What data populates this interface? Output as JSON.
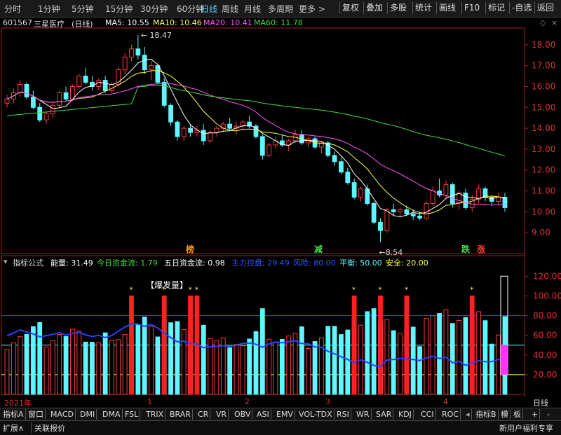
{
  "toolbar": {
    "tabs": [
      "分时",
      "1分钟",
      "5分钟",
      "15分钟",
      "30分钟",
      "60分钟",
      "日线",
      "周线",
      "月线",
      "多周期",
      "更多 >"
    ],
    "active_tab": "日线",
    "right_buttons": [
      "复权",
      "叠加",
      "多股",
      "统计",
      "画线",
      "F10",
      "标记",
      "-自选",
      "返回"
    ]
  },
  "stock": {
    "code": "601567",
    "name": "三星医疗",
    "period": "(日线)",
    "ma5": "MA5: 10.55",
    "ma10": "MA10: 10.46",
    "ma20": "MA20: 10.41",
    "ma60": "MA60: 11.78",
    "high_label": "18.47",
    "low_label": "8.54"
  },
  "price_axis": [
    18.0,
    17.0,
    16.0,
    15.0,
    14.0,
    13.0,
    12.0,
    11.0,
    10.0,
    9.0
  ],
  "markers": [
    "榜",
    "减",
    "跌",
    "涨"
  ],
  "indicator": {
    "name": "指标公式",
    "energy": "能量: 31.49",
    "today_flow": "今日资金流: 1.79",
    "five_day_flow": "五日资金流: 0.98",
    "main_control": "主力控盘: 29.49",
    "risk": "风险: 80.00",
    "balance": "平衡: 50.00",
    "safe": "安全: 20.00",
    "annotation": "【爆发量】",
    "axis": [
      120.0,
      100.0,
      80.0,
      60.0,
      40.0,
      20.0
    ]
  },
  "dates": [
    "2021年",
    "1",
    "2",
    "3",
    "4"
  ],
  "indicator_tabs": [
    "指标A",
    "窗口",
    "MACD",
    "DMI",
    "DMA",
    "FSL",
    "TRIX",
    "BRAR",
    "CR",
    "VR",
    "OBV",
    "ASI",
    "EMV",
    "VOL-TDX",
    "RSI",
    "WR",
    "SAR",
    "KDJ",
    "CCI",
    "ROC",
    "指标B",
    "模",
    "板",
    "+",
    "-"
  ],
  "period_label": "日线",
  "bottom": {
    "left1": "扩展∧",
    "left2": "关联报价",
    "right": "新用户福利专享"
  },
  "colors": {
    "up": "#ff3b3b",
    "down": "#5ef6ff",
    "ma5": "#ffffff",
    "ma10": "#ffff55",
    "ma20": "#ff55ff",
    "ma60": "#44dd44",
    "accent": "#5bc8ff"
  },
  "chart_data": [
    {
      "type": "candlestick",
      "title": "601567 三星医疗 (日线)",
      "ylim": [
        8.0,
        18.8
      ],
      "y_ticks": [
        18,
        17,
        16,
        15,
        14,
        13,
        12,
        11,
        10,
        9
      ],
      "x_labels": [
        "2021年",
        "1",
        "2",
        "3",
        "4"
      ],
      "ohlc": [
        [
          15.2,
          15.6,
          15.0,
          15.4
        ],
        [
          15.4,
          15.9,
          15.2,
          15.7
        ],
        [
          15.7,
          16.3,
          15.5,
          16.1
        ],
        [
          16.1,
          16.2,
          15.4,
          15.5
        ],
        [
          15.5,
          15.8,
          14.9,
          15.0
        ],
        [
          15.0,
          15.2,
          14.3,
          14.4
        ],
        [
          14.4,
          14.8,
          14.2,
          14.7
        ],
        [
          14.7,
          15.2,
          14.5,
          15.1
        ],
        [
          15.1,
          15.8,
          15.0,
          15.7
        ],
        [
          15.7,
          16.0,
          15.3,
          15.4
        ],
        [
          15.4,
          16.1,
          15.3,
          16.0
        ],
        [
          16.0,
          16.6,
          15.9,
          16.5
        ],
        [
          16.5,
          16.9,
          16.1,
          16.2
        ],
        [
          16.2,
          16.5,
          15.8,
          16.0
        ],
        [
          16.0,
          16.4,
          15.8,
          16.3
        ],
        [
          16.3,
          16.5,
          15.7,
          15.8
        ],
        [
          15.8,
          16.2,
          15.7,
          16.1
        ],
        [
          16.1,
          16.9,
          16.0,
          16.8
        ],
        [
          16.8,
          17.6,
          16.6,
          17.4
        ],
        [
          17.4,
          18.0,
          17.2,
          17.8
        ],
        [
          17.8,
          18.47,
          17.3,
          17.5
        ],
        [
          17.5,
          17.9,
          16.6,
          16.8
        ],
        [
          16.8,
          17.2,
          16.3,
          17.0
        ],
        [
          17.0,
          17.1,
          16.1,
          16.2
        ],
        [
          16.2,
          16.4,
          15.0,
          15.1
        ],
        [
          15.1,
          15.2,
          14.1,
          14.3
        ],
        [
          14.3,
          14.4,
          13.4,
          13.6
        ],
        [
          13.6,
          14.1,
          13.4,
          14.0
        ],
        [
          14.0,
          14.2,
          13.6,
          13.8
        ],
        [
          13.8,
          14.1,
          13.6,
          13.9
        ],
        [
          13.9,
          14.2,
          13.2,
          13.4
        ],
        [
          13.4,
          13.9,
          13.3,
          13.8
        ],
        [
          13.8,
          14.1,
          13.6,
          14.0
        ],
        [
          14.0,
          14.3,
          13.8,
          14.2
        ],
        [
          14.2,
          14.5,
          13.9,
          14.0
        ],
        [
          14.0,
          14.3,
          13.7,
          14.1
        ],
        [
          14.1,
          14.4,
          13.9,
          14.3
        ],
        [
          14.3,
          14.6,
          14.0,
          14.1
        ],
        [
          14.1,
          14.2,
          13.5,
          13.6
        ],
        [
          13.6,
          13.7,
          12.5,
          12.7
        ],
        [
          12.7,
          13.3,
          12.6,
          13.2
        ],
        [
          13.2,
          13.6,
          13.0,
          13.4
        ],
        [
          13.4,
          13.7,
          13.1,
          13.2
        ],
        [
          13.2,
          13.5,
          12.9,
          13.4
        ],
        [
          13.4,
          13.9,
          13.3,
          13.7
        ],
        [
          13.7,
          13.9,
          13.2,
          13.3
        ],
        [
          13.3,
          13.6,
          13.1,
          13.5
        ],
        [
          13.5,
          13.6,
          13.0,
          13.1
        ],
        [
          13.1,
          13.4,
          12.8,
          13.3
        ],
        [
          13.3,
          13.4,
          12.6,
          12.7
        ],
        [
          12.7,
          12.9,
          12.2,
          12.4
        ],
        [
          12.4,
          12.6,
          11.8,
          11.9
        ],
        [
          11.9,
          12.1,
          11.3,
          11.4
        ],
        [
          11.4,
          11.6,
          10.6,
          10.7
        ],
        [
          10.7,
          11.2,
          10.5,
          11.1
        ],
        [
          11.1,
          11.3,
          10.3,
          10.4
        ],
        [
          10.4,
          10.5,
          9.4,
          9.5
        ],
        [
          9.5,
          9.7,
          8.54,
          9.1
        ],
        [
          9.1,
          10.2,
          9.0,
          10.1
        ],
        [
          10.1,
          10.4,
          9.8,
          10.0
        ],
        [
          10.0,
          10.2,
          9.7,
          10.1
        ],
        [
          10.1,
          10.3,
          9.8,
          9.9
        ],
        [
          9.9,
          10.1,
          9.6,
          9.8
        ],
        [
          9.8,
          10.0,
          9.6,
          9.7
        ],
        [
          9.7,
          10.5,
          9.6,
          10.4
        ],
        [
          10.4,
          11.2,
          10.3,
          11.0
        ],
        [
          11.0,
          11.6,
          10.7,
          10.8
        ],
        [
          10.8,
          11.5,
          10.6,
          11.3
        ],
        [
          11.3,
          11.4,
          10.2,
          10.4
        ],
        [
          10.4,
          11.0,
          10.1,
          10.9
        ],
        [
          10.9,
          11.1,
          10.1,
          10.2
        ],
        [
          10.2,
          10.8,
          10.0,
          10.6
        ],
        [
          10.6,
          11.3,
          10.4,
          11.1
        ],
        [
          11.1,
          11.2,
          10.5,
          10.7
        ],
        [
          10.7,
          10.8,
          10.3,
          10.5
        ],
        [
          10.5,
          10.9,
          10.3,
          10.7
        ],
        [
          10.7,
          10.9,
          10.0,
          10.2
        ]
      ]
    },
    {
      "type": "bar",
      "title": "指标公式",
      "ylim": [
        0,
        128
      ],
      "y_ticks": [
        120,
        100,
        80,
        60,
        40,
        20
      ],
      "reference_lines": {
        "risk": 80,
        "balance": 50,
        "safe": 20
      },
      "energy_last": 31.49,
      "main_control_last": 29.49
    }
  ]
}
